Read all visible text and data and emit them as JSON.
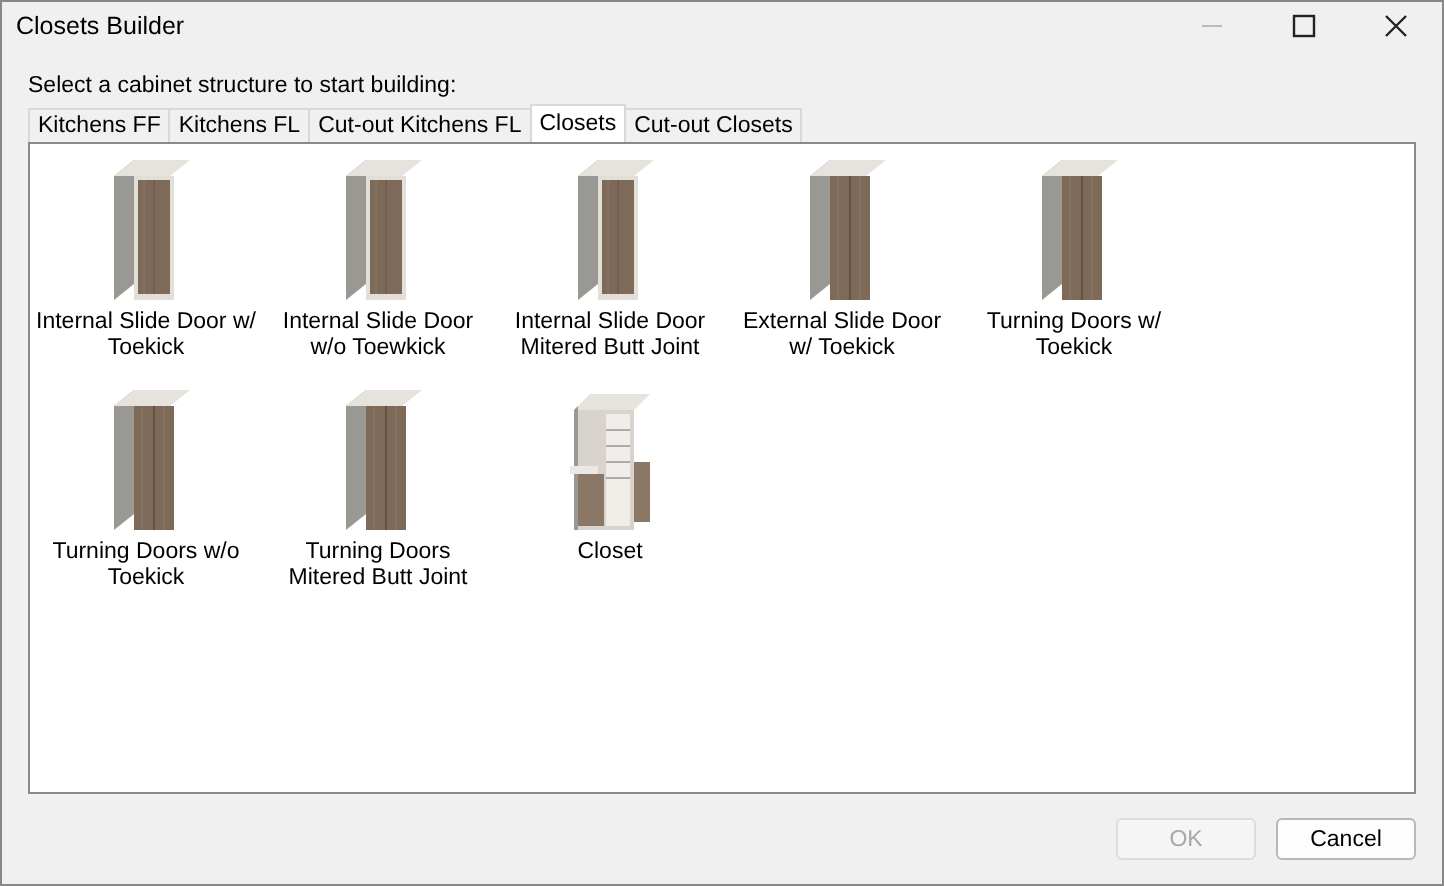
{
  "window": {
    "title": "Closets Builder"
  },
  "prompt": "Select a cabinet structure to start building:",
  "tabs": [
    {
      "label": "Kitchens FF",
      "selected": false
    },
    {
      "label": "Kitchens FL",
      "selected": false
    },
    {
      "label": "Cut-out Kitchens FL",
      "selected": false
    },
    {
      "label": "Closets",
      "selected": true
    },
    {
      "label": "Cut-out Closets",
      "selected": false
    }
  ],
  "items": [
    {
      "label": "Internal Slide Door w/ Toekick",
      "kind": "slide"
    },
    {
      "label": "Internal Slide Door w/o Toewkick",
      "kind": "slide"
    },
    {
      "label": "Internal Slide Door Mitered Butt Joint",
      "kind": "slide"
    },
    {
      "label": "External Slide Door w/ Toekick",
      "kind": "door"
    },
    {
      "label": "Turning Doors w/ Toekick",
      "kind": "door"
    },
    {
      "label": "Turning Doors  w/o Toekick",
      "kind": "door"
    },
    {
      "label": "Turning Doors Mitered Butt Joint",
      "kind": "door"
    },
    {
      "label": "Closet",
      "kind": "open"
    }
  ],
  "buttons": [
    {
      "label": "OK",
      "disabled": true
    },
    {
      "label": "Cancel",
      "disabled": false
    }
  ]
}
